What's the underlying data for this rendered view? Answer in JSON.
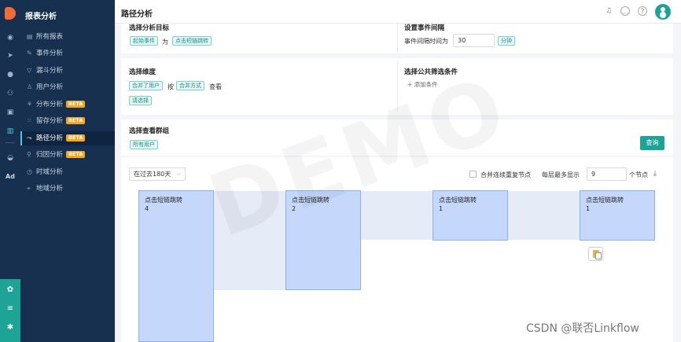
{
  "sidebar": {
    "title": "报表分析",
    "items": [
      {
        "label": "所有报表",
        "icon": "chart-icon",
        "beta": ""
      },
      {
        "label": "事件分析",
        "icon": "edit-icon",
        "beta": ""
      },
      {
        "label": "漏斗分析",
        "icon": "funnel-icon",
        "beta": ""
      },
      {
        "label": "用户分析",
        "icon": "user-icon",
        "beta": ""
      },
      {
        "label": "分布分析",
        "icon": "distribution-icon",
        "beta": "BETA"
      },
      {
        "label": "留存分析",
        "icon": "retention-icon",
        "beta": "BETA"
      },
      {
        "label": "路径分析",
        "icon": "path-icon",
        "beta": "BETA"
      },
      {
        "label": "归因分析",
        "icon": "attribution-icon",
        "beta": "BETA"
      },
      {
        "label": "时域分析",
        "icon": "time-icon",
        "beta": ""
      },
      {
        "label": "地域分析",
        "icon": "location-icon",
        "beta": ""
      }
    ],
    "active": "路径分析"
  },
  "rail": {
    "ad_label": "Ad"
  },
  "header": {
    "title": "路径分析"
  },
  "target": {
    "title": "选择分析目标",
    "start_tag": "起始事件",
    "connector": "为",
    "event_tag": "点击短链跳转"
  },
  "interval": {
    "title": "设置事件间隔",
    "label": "事件间隔时间为",
    "value": "30",
    "unit": "分钟"
  },
  "dimension": {
    "title": "选择维度",
    "merge_user": "合并了用户",
    "by": "按",
    "merge_method": "合并方式",
    "view": "查看",
    "select": "请选择"
  },
  "filter": {
    "title": "选择公共筛选条件",
    "add": "+ 添加条件"
  },
  "group": {
    "title": "选择查看群组",
    "tag": "所有用户",
    "query_button": "查询"
  },
  "flow": {
    "range": "在过去180天",
    "merge_checkbox": "合并连续重复节点",
    "max_label": "每层最多显示",
    "max_value": "9",
    "unit": "个节点",
    "nodes": [
      {
        "label": "点击短链跳转",
        "value": "4"
      },
      {
        "label": "点击短链跳转",
        "value": "2"
      },
      {
        "label": "点击短链跳转",
        "value": "1"
      },
      {
        "label": "点击短链跳转",
        "value": "1"
      }
    ]
  },
  "watermark": "DEMO",
  "footer_watermark": "CSDN @联否Linkflow"
}
